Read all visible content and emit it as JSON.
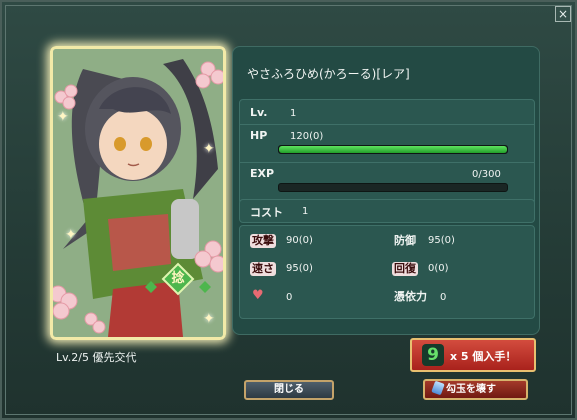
{
  "window": {
    "close_icon": "×"
  },
  "card": {
    "emblem_char": "捻",
    "colors": {
      "frame": "#f2eaa8",
      "accent": "#4db64d"
    }
  },
  "character": {
    "name": "やさふろひめ(かろーる)[レア]",
    "level_label": "Lv.",
    "level_value": "1",
    "hp_label": "HP",
    "hp_value": "120(0)",
    "hp_fill": 1.0,
    "exp_label": "EXP",
    "exp_value": "0/300",
    "exp_fill": 0.0,
    "cost_label": "コスト",
    "cost_value": "1",
    "stats": {
      "attack_label": "攻撃",
      "attack_value": "90(0)",
      "defense_label": "防御",
      "defense_value": "95(0)",
      "speed_label": "速さ",
      "speed_value": "95(0)",
      "recovery_label": "回復",
      "recovery_value": "0(0)",
      "affection_value": "0",
      "possession_label": "憑依力",
      "possession_value": "0"
    }
  },
  "footer": {
    "level_text": "Lv.2/5 優先交代",
    "get_count": "9",
    "get_text": "x 5 個入手！",
    "close_label": "閉じる",
    "break_label": "勾玉を壊す"
  }
}
